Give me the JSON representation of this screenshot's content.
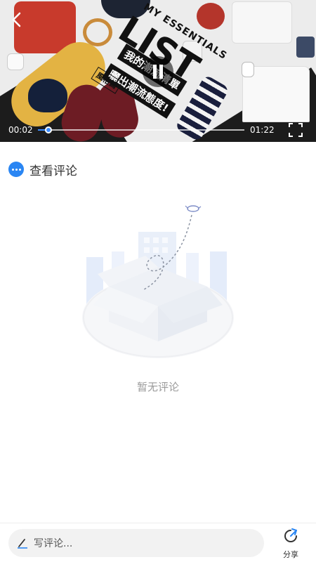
{
  "video": {
    "banner": {
      "line1": "MY ESSENTIALS",
      "line2": "LIST",
      "line3": "我的潮流清單",
      "line4": "曬出潮流態度!",
      "line5": "風格篇"
    },
    "current_time": "00:02",
    "total_time": "01:22",
    "progress": 0.05,
    "accent_color": "#3b8cff"
  },
  "comments": {
    "title": "查看评论",
    "empty_text": "暂无评论"
  },
  "bottom_bar": {
    "input_placeholder": "写评论...",
    "share_label": "分享"
  },
  "icons": [
    "back-arrow-icon",
    "pause-icon",
    "fullscreen-icon",
    "comment-bubble-icon",
    "pen-icon",
    "share-icon"
  ]
}
